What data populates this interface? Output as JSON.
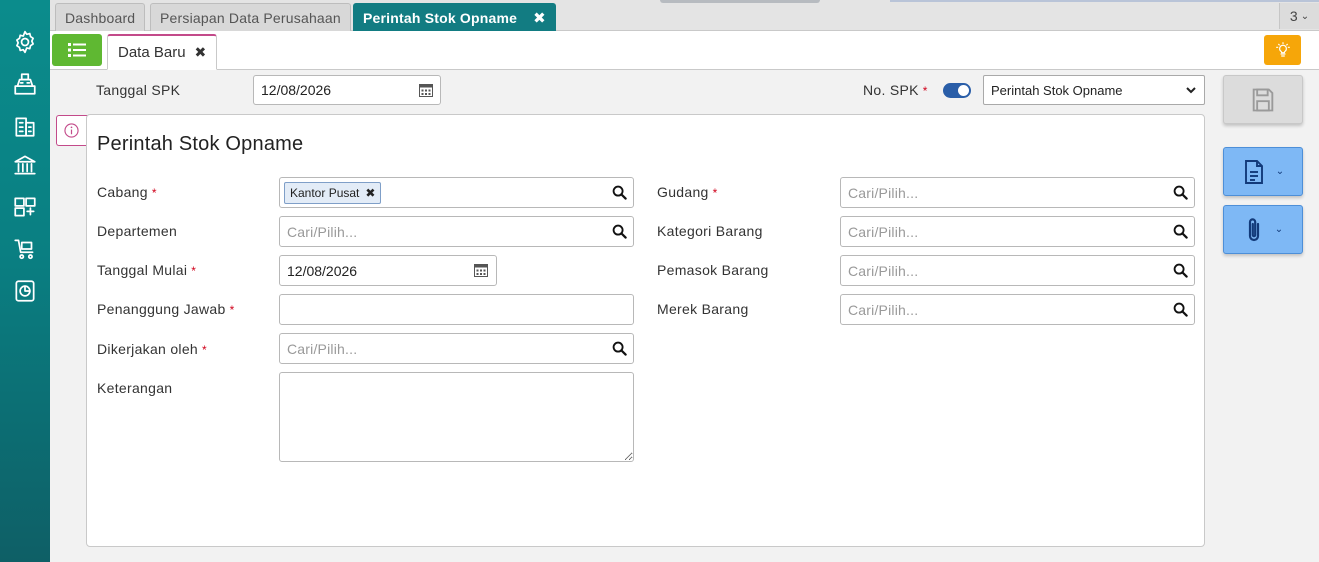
{
  "colors": {
    "sidebar": "#0b8c8c",
    "active_tab": "#127c82",
    "menu_button": "#5fb832",
    "subtab_accent": "#c34a8a",
    "bulb_button": "#f6a609",
    "toggle_on": "#2a5ea8",
    "side_button": "#7eb8f5",
    "required": "#d0021b"
  },
  "sidebar": {
    "icons": [
      "gear-icon",
      "cash-register-icon",
      "building-icon",
      "bank-icon",
      "inventory-icon",
      "cart-icon",
      "report-icon"
    ]
  },
  "top_tabs": [
    {
      "label": "Dashboard",
      "active": false
    },
    {
      "label": "Persiapan Data Perusahaan",
      "active": false
    },
    {
      "label": "Perintah Stok Opname",
      "active": true,
      "close": "✖"
    }
  ],
  "top_tab_count": "3",
  "sub_tab": {
    "label": "Data Baru",
    "close": "✖"
  },
  "header": {
    "tanggal_spk_label": "Tanggal SPK",
    "tanggal_spk_value": "12/08/2026",
    "no_spk_label": "No. SPK",
    "required_mark": "*",
    "no_spk_auto": true,
    "no_spk_select": "Perintah Stok Opname"
  },
  "form": {
    "title": "Perintah Stok Opname",
    "placeholder": "Cari/Pilih...",
    "left": {
      "cabang_label": "Cabang",
      "cabang_chip": "Kantor Pusat",
      "chip_close": "✖",
      "departemen_label": "Departemen",
      "tanggal_mulai_label": "Tanggal Mulai",
      "tanggal_mulai_value": "12/08/2026",
      "penanggung_jawab_label": "Penanggung Jawab",
      "dikerjakan_oleh_label": "Dikerjakan oleh",
      "keterangan_label": "Keterangan"
    },
    "right": {
      "gudang_label": "Gudang",
      "kategori_label": "Kategori Barang",
      "pemasok_label": "Pemasok Barang",
      "merek_label": "Merek Barang"
    }
  }
}
